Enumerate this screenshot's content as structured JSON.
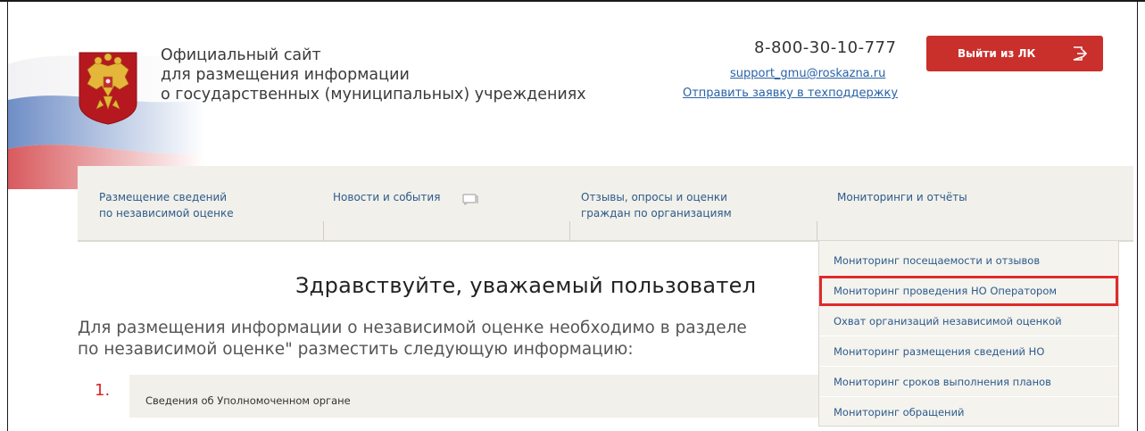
{
  "header": {
    "site_title_lines": [
      "Официальный сайт",
      "для размещения информации",
      "о государственных (муниципальных) учреждениях"
    ],
    "phone": "8-800-30-10-777",
    "support_email": "support_gmu@roskazna.ru",
    "support_request_link": "Отправить заявку в техподдержку",
    "logout_label": "Выйти из ЛК"
  },
  "nav": {
    "items": [
      {
        "label_lines": [
          "Размещение сведений",
          "по независимой оценке"
        ]
      },
      {
        "label_lines": [
          "Новости и события"
        ]
      },
      {
        "label_lines": [
          "Отзывы, опросы и оценки",
          "граждан по организациям"
        ]
      },
      {
        "label_lines": [
          "Мониторинги и отчёты"
        ]
      }
    ]
  },
  "dropdown": {
    "items": [
      "Мониторинг посещаемости и отзывов",
      "Мониторинг проведения НО Оператором",
      "Охват организаций независимой оценкой",
      "Мониторинг размещения сведений НО",
      "Мониторинг сроков выполнения планов",
      "Мониторинг обращений"
    ],
    "highlighted_index": 1
  },
  "main": {
    "greeting": "Здравствуйте, уважаемый пользовател",
    "intro_lines": [
      "Для размещения информации о независимой оценке необходимо в разделе",
      "по независимой оценке\" разместить следующую информацию:"
    ],
    "steps": [
      {
        "number": "1.",
        "label": "Сведения об Уполномоченном органе"
      }
    ]
  },
  "colors": {
    "accent_red": "#c9302c",
    "link_blue": "#2a62a8",
    "nav_bg": "#f1f0ea",
    "highlight_outline": "#e12a2a"
  }
}
